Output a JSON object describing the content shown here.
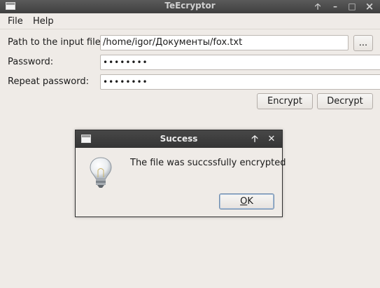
{
  "window": {
    "title": "TeEcryptor",
    "controls": {
      "raise": "🡡",
      "minimize": "–",
      "maximize": "□",
      "close": "×"
    }
  },
  "menu": {
    "items": [
      "File",
      "Help"
    ]
  },
  "form": {
    "path_label": "Path to the input file:",
    "path_value": "/home/igor/Документы/fox.txt",
    "browse_label": "...",
    "password_label": "Password:",
    "password_value": "••••••••",
    "repeat_label": "Repeat password:",
    "repeat_value": "••••••••",
    "encrypt_label": "Encrypt",
    "decrypt_label": "Decrypt"
  },
  "dialog": {
    "title": "Success",
    "controls": {
      "raise": "🡡",
      "close": "✕"
    },
    "message": "The file was succssfully encrypted",
    "ok_label_first": "O",
    "ok_label_rest": "K",
    "icon": "lightbulb-icon"
  }
}
